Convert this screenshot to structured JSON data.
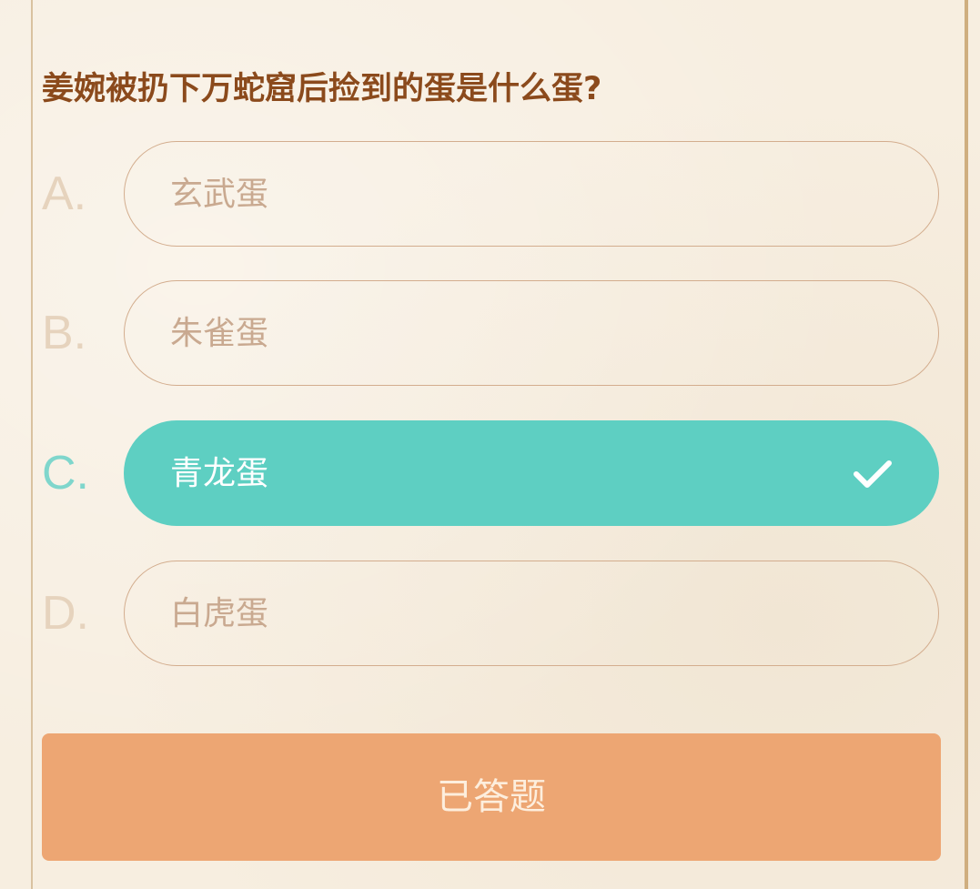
{
  "quiz": {
    "question": "姜婉被扔下万蛇窟后捡到的蛋是什么蛋?",
    "selected": "C",
    "options": [
      {
        "letter": "A.",
        "text": "玄武蛋"
      },
      {
        "letter": "B.",
        "text": "朱雀蛋"
      },
      {
        "letter": "C.",
        "text": "青龙蛋"
      },
      {
        "letter": "D.",
        "text": "白虎蛋"
      }
    ],
    "submit_label": "已答题"
  },
  "colors": {
    "selected": "#5ecfc2",
    "button": "#eda673",
    "question_text": "#8b4a1c"
  },
  "icons": {
    "selected_marker": "check-icon"
  }
}
